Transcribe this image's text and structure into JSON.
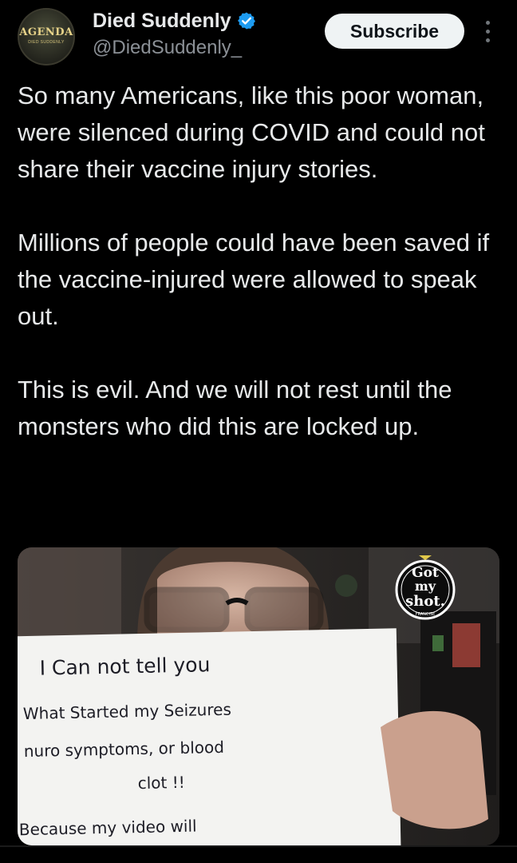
{
  "account": {
    "display_name": "Died Suddenly",
    "handle": "@DiedSuddenly_",
    "avatar_text": "AGENDA",
    "avatar_subtext": "DIED SUDDENLY",
    "verified_color": "#1d9bf0"
  },
  "actions": {
    "subscribe_label": "Subscribe",
    "more_icon": "vertical-ellipsis-icon"
  },
  "post": {
    "paragraphs": [
      "So many Americans, like this poor woman, were silenced during COVID and could not share their vaccine injury stories.",
      "Millions of people could have been saved if the vaccine-injured were allowed to speak out.",
      "This is evil. And we will not rest until the monsters who did this are locked up."
    ]
  },
  "media": {
    "badge_line1": "Got",
    "badge_line2": "my",
    "badge_line3": "shot.",
    "badge_small": "FRANCISE",
    "sign_lines": [
      "I Can not tell you",
      "What Started my Seizures",
      "nuro symptoms, or blood",
      "clot !!",
      "Because my video will"
    ]
  }
}
